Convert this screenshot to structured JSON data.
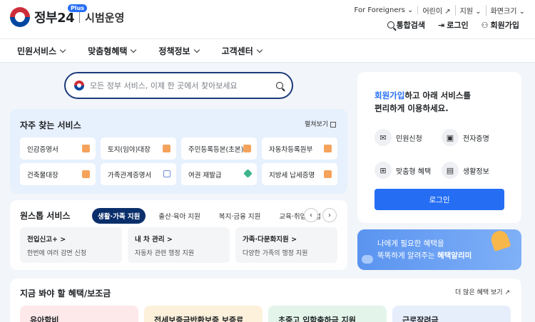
{
  "header": {
    "logo_main": "정부24",
    "logo_badge": "Plus",
    "logo_sub": "시범운영",
    "util_links": [
      "For Foreigners",
      "어린이",
      "지원",
      "화면크기"
    ],
    "quick_links": [
      {
        "label": "통합검색",
        "icon": "search-icon"
      },
      {
        "label": "로그인",
        "icon": "login-icon"
      },
      {
        "label": "회원가입",
        "icon": "user-add-icon"
      }
    ]
  },
  "nav": {
    "items": [
      "민원서비스",
      "맞춤형혜택",
      "정책정보",
      "고객센터"
    ]
  },
  "search": {
    "placeholder": "모든 정부 서비스, 이제 한 곳에서 찾아보세요"
  },
  "frequent": {
    "title": "자주 찾는 서비스",
    "more": "펼쳐보기",
    "items": [
      {
        "label": "인감증명서",
        "icon": "document-icon"
      },
      {
        "label": "토지(임야)대장",
        "icon": "document-icon"
      },
      {
        "label": "주민등록등본(초본)",
        "icon": "document-icon"
      },
      {
        "label": "자동차등록원부",
        "icon": "document-icon"
      },
      {
        "label": "건축물대장",
        "icon": "document-icon"
      },
      {
        "label": "가족관계증명서",
        "icon": "external-link-icon"
      },
      {
        "label": "여권 재발급",
        "icon": "edit-icon"
      },
      {
        "label": "지방세 납세증명",
        "icon": "document-icon"
      }
    ]
  },
  "onestop": {
    "title": "원스톱 서비스",
    "tabs": [
      "생활·가족 지원",
      "출산·육아 지원",
      "복지·금융 지원",
      "교육·취업·기업 지원"
    ],
    "items": [
      {
        "title": "전입신고+ >",
        "desc": "한번에 여러 감면 신청"
      },
      {
        "title": "내 차 관리 >",
        "desc": "자동차 관련 행정 지원"
      },
      {
        "title": "가족·다문화지원 >",
        "desc": "다양한 가족의 행정 지원"
      }
    ]
  },
  "login_card": {
    "msg_highlight": "회원가입",
    "msg_rest1": "하고 아래 서비스를",
    "msg_line2": "편리하게 이용하세요.",
    "features": [
      "민원신청",
      "전자증명",
      "맞춤형 혜택",
      "생활정보"
    ],
    "button": "로그인"
  },
  "banner": {
    "line1": "나에게 필요한 혜택을",
    "line2_plain": "똑똑하게 알려주는 ",
    "line2_bold": "혜택알리미"
  },
  "benefits": {
    "title": "지금 봐야 할 혜택/보조금",
    "more": "더 많은 혜택 보기",
    "cards": [
      "유아학비",
      "전세보증금반환보증 보증료 지원",
      "초중고 입학축하금 지원",
      "근로장려금"
    ]
  }
}
